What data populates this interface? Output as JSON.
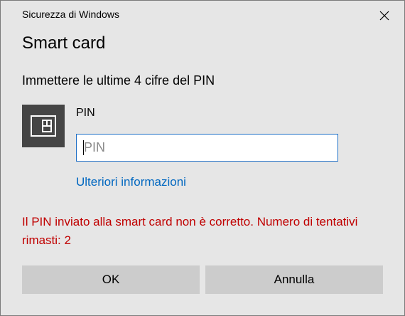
{
  "window": {
    "title": "Sicurezza di Windows",
    "close_icon": "close-icon"
  },
  "dialog": {
    "heading": "Smart card",
    "prompt": "Immettere le ultime 4 cifre del PIN",
    "card_icon": "smart-card-icon",
    "pin_label": "PIN",
    "pin_placeholder": "PIN",
    "pin_value": "",
    "more_info_link": "Ulteriori informazioni",
    "error_message": "Il PIN inviato alla smart card non è corretto. Numero di tentativi rimasti: 2"
  },
  "buttons": {
    "ok": "OK",
    "cancel": "Annulla"
  },
  "colors": {
    "background": "#e6e6e6",
    "icon_tile": "#454545",
    "link": "#0067c0",
    "error": "#c00000",
    "input_border": "#1e6fc6",
    "button": "#cccccc"
  }
}
